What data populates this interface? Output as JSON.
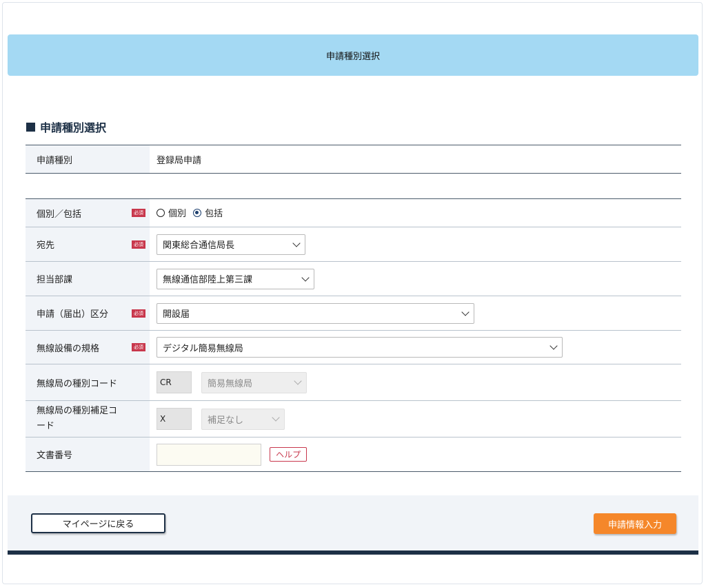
{
  "banner": {
    "title": "申請種別選択"
  },
  "section": {
    "title": "申請種別選択"
  },
  "summary": {
    "label": "申請種別",
    "value": "登録局申請"
  },
  "required_badge": "必須",
  "form": {
    "individual": {
      "label": "個別／包括",
      "options": [
        "個別",
        "包括"
      ],
      "selected": "包括"
    },
    "destination": {
      "label": "宛先",
      "value": "関東総合通信局長"
    },
    "department": {
      "label": "担当部課",
      "value": "無線通信部陸上第三課"
    },
    "application_type": {
      "label": "申請（届出）区分",
      "value": "開設届"
    },
    "equipment_spec": {
      "label": "無線設備の規格",
      "value": "デジタル簡易無線局"
    },
    "station_type_code": {
      "label": "無線局の種別コード",
      "code": "CR",
      "value": "簡易無線局"
    },
    "station_subcode": {
      "label_line1": "無線局の種別補足コ",
      "label_line2": "ード",
      "code": "X",
      "value": "補足なし"
    },
    "document_number": {
      "label": "文書番号",
      "value": "",
      "help_label": "ヘルプ"
    }
  },
  "footer": {
    "back_label": "マイページに戻る",
    "next_label": "申請情報入力"
  }
}
